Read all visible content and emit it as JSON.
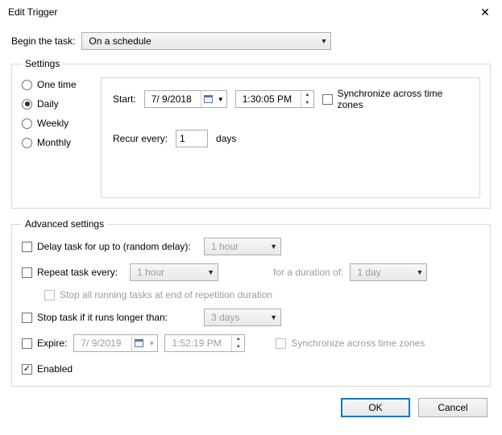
{
  "window": {
    "title": "Edit Trigger",
    "close_x": "✕"
  },
  "begin": {
    "label": "Begin the task:",
    "value": "On a schedule"
  },
  "settings": {
    "legend": "Settings",
    "one_time": "One time",
    "daily": "Daily",
    "weekly": "Weekly",
    "monthly": "Monthly",
    "start_label": "Start:",
    "start_date": "7/ 9/2018",
    "start_time": "1:30:05 PM",
    "sync_tz": "Synchronize across time zones",
    "recur_label": "Recur every:",
    "recur_value": "1",
    "recur_unit": "days"
  },
  "advanced": {
    "legend": "Advanced settings",
    "delay_label": "Delay task for up to (random delay):",
    "delay_value": "1 hour",
    "repeat_label": "Repeat task every:",
    "repeat_value": "1 hour",
    "duration_label": "for a duration of:",
    "duration_value": "1 day",
    "stop_all_label": "Stop all running tasks at end of repetition duration",
    "stop_if_label": "Stop task if it runs longer than:",
    "stop_if_value": "3 days",
    "expire_label": "Expire:",
    "expire_date": "7/ 9/2019",
    "expire_time": "1:52:19 PM",
    "expire_sync": "Synchronize across time zones",
    "enabled_label": "Enabled"
  },
  "footer": {
    "ok": "OK",
    "cancel": "Cancel"
  }
}
